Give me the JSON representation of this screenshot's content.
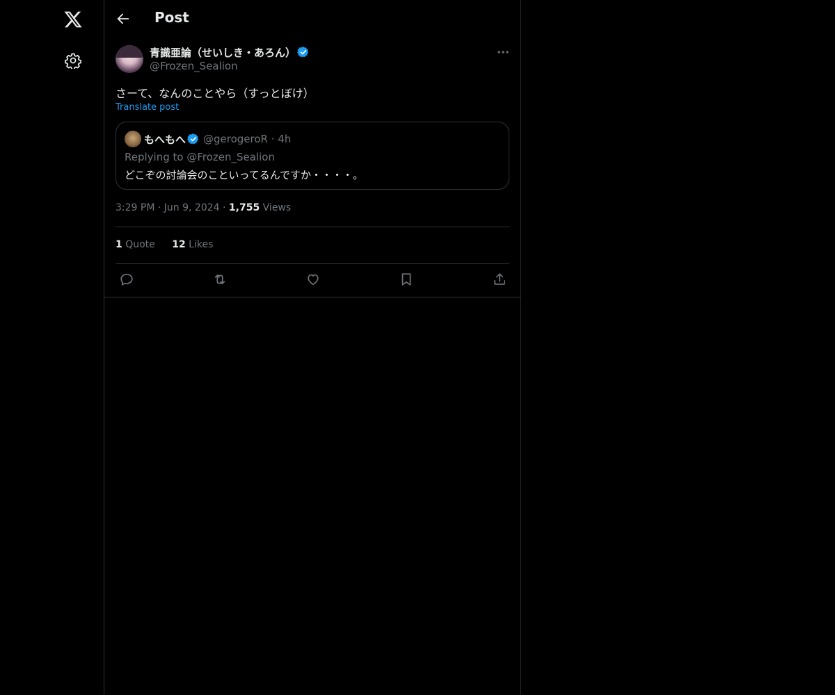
{
  "header": {
    "title": "Post"
  },
  "post": {
    "author_name": "青識亜論（せいしき・あろん）",
    "author_handle": "@Frozen_Sealion",
    "text": "さーて、なんのことやら（すっとぼけ）",
    "translate_label": "Translate post",
    "time": "3:29 PM",
    "date": "Jun 9, 2024",
    "views_count": "1,755",
    "views_label": "Views",
    "separator": "·"
  },
  "quote": {
    "author_name": "もへもへ",
    "author_handle": "@gerogeroR",
    "time_ago": "4h",
    "separator": "·",
    "replying_to": "Replying to @Frozen_Sealion",
    "text": "どこぞの討論会のこといってるんですか・・・・。"
  },
  "stats": {
    "quotes_count": "1",
    "quotes_label": "Quote",
    "likes_count": "12",
    "likes_label": "Likes"
  },
  "colors": {
    "background": "#000000",
    "text": "#e7e9ea",
    "muted": "#71767b",
    "accent": "#1d9bf0",
    "border": "#2f3336"
  },
  "icons": [
    "x-logo-icon",
    "gear-icon",
    "back-arrow-icon",
    "verified-badge-icon",
    "more-icon",
    "reply-icon",
    "repost-icon",
    "like-icon",
    "bookmark-icon",
    "share-icon"
  ]
}
